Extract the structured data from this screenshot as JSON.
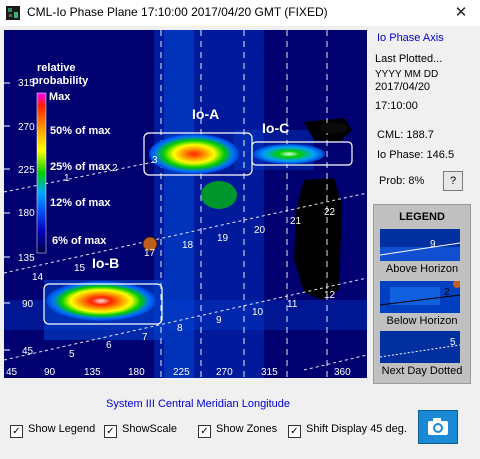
{
  "window": {
    "title": "CML-Io Phase Plane 17:10:00  2017/04/20 GMT (FIXED)",
    "close_glyph": "✕"
  },
  "plot": {
    "y_ticks": [
      "315",
      "270",
      "225",
      "180",
      "135",
      "90",
      "45"
    ],
    "x_ticks": [
      "45",
      "90",
      "135",
      "180",
      "225",
      "270",
      "315",
      "360"
    ],
    "scale": {
      "title_line1": "relative",
      "title_line2": "probability",
      "max_label": "Max",
      "label_50": "50% of max",
      "label_25": "25% of max",
      "label_12": "12% of max",
      "label_6": "6% of max"
    },
    "zones": {
      "io_a": "Io-A",
      "io_b": "Io-B",
      "io_c": "Io-C"
    },
    "track_labels": {
      "line1": [
        "1",
        "2",
        "3"
      ],
      "line2": [
        "14",
        "15",
        "17",
        "18",
        "19",
        "20",
        "21",
        "22"
      ],
      "line3": [
        "5",
        "6",
        "7",
        "8",
        "9",
        "10",
        "11",
        "12"
      ]
    }
  },
  "x_axis_title": "System III Central Meridian Longitude",
  "side_panel": {
    "axis_title": "Io Phase Axis",
    "last_plotted": "Last Plotted...",
    "date_format": "YYYY MM DD",
    "date": "2017/04/20",
    "time": "17:10:00",
    "cml": "CML: 188.7",
    "io_phase": "Io Phase: 146.5",
    "prob": "Prob:  8%",
    "prob_button": "?"
  },
  "legend": {
    "title": "LEGEND",
    "above_label": "Above Horizon",
    "below_label": "Below Horizon",
    "next_day_label": "Next Day Dotted",
    "above_num": "9",
    "below_num": "2",
    "next_day_num": "5"
  },
  "checkboxes": [
    {
      "label": "Show Legend",
      "checked": true
    },
    {
      "label": "ShowScale",
      "checked": true
    },
    {
      "label": "Show Zones",
      "checked": true
    },
    {
      "label": "Shift Display 45 deg.",
      "checked": true
    }
  ],
  "colors": {
    "background": "#000060",
    "max": "#ff2000",
    "high": "#ff9900",
    "mid": "#ffff00",
    "low": "#00cc00",
    "low2": "#0070ff",
    "accent": "#0000cc"
  }
}
